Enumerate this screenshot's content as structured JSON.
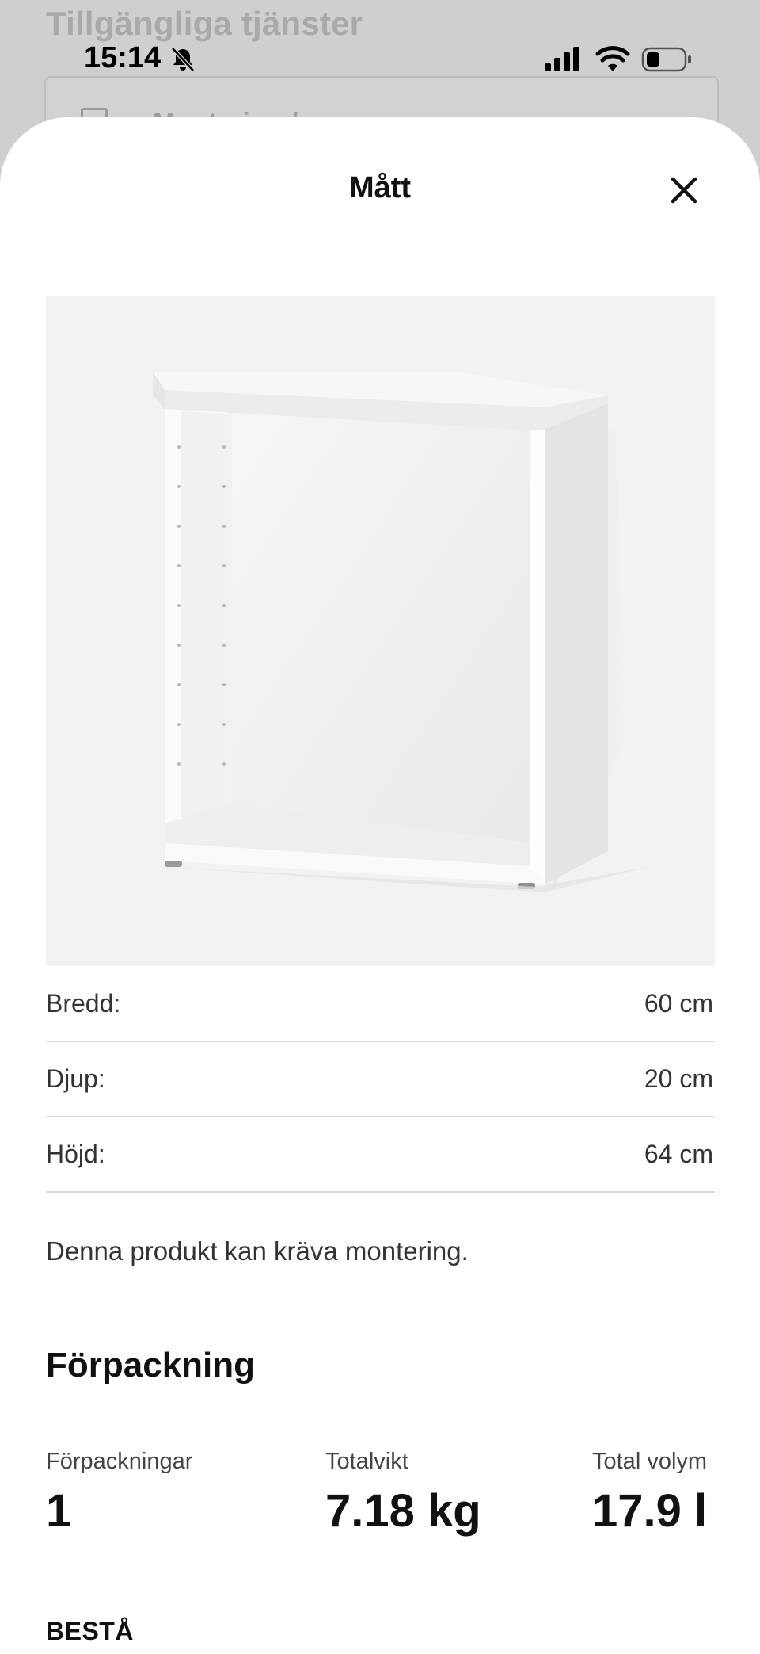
{
  "background_page": {
    "title": "Tillgängliga tjänster",
    "card_label": "Montering / ..."
  },
  "status_bar": {
    "time": "15:14",
    "icons": [
      "bell-slash-icon",
      "cellular-signal-icon",
      "wifi-icon",
      "battery-icon"
    ]
  },
  "sheet": {
    "title": "Mått",
    "close_icon": "close-icon"
  },
  "dimensions": [
    {
      "label": "Bredd:",
      "value": "60 cm"
    },
    {
      "label": "Djup:",
      "value": "20 cm"
    },
    {
      "label": "Höjd:",
      "value": "64 cm"
    }
  ],
  "assembly_note": "Denna produkt kan kräva montering.",
  "packaging": {
    "title": "Förpackning",
    "items": [
      {
        "label": "Förpackningar",
        "value": "1"
      },
      {
        "label": "Totalvikt",
        "value": "7.18 kg"
      },
      {
        "label": "Total volym",
        "value": "17.9 l"
      }
    ]
  },
  "product_name": "BESTÅ",
  "colors": {
    "overlay": "#cfcfcf",
    "sheet": "#ffffff",
    "divider": "#d9d9d9",
    "image_bg": "#f2f2f2"
  }
}
